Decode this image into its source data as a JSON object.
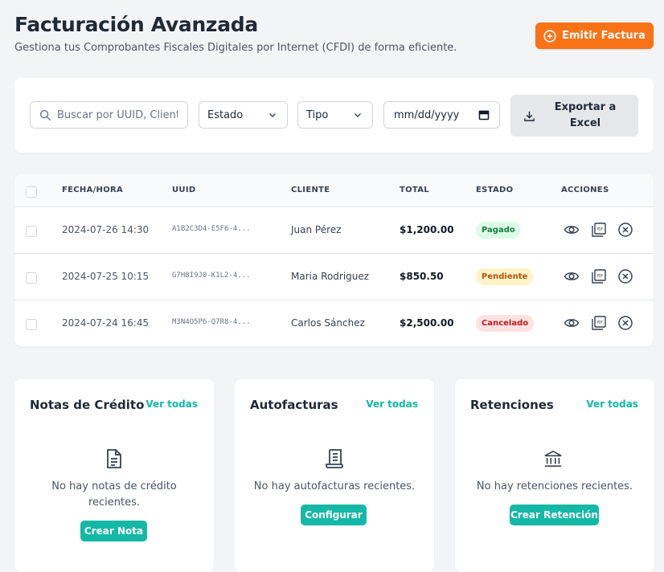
{
  "header": {
    "title": "Facturación Avanzada",
    "subtitle": "Gestiona tus Comprobantes Fiscales Digitales por Internet (CFDI) de forma eficiente.",
    "primary_button": "Emitir Factura",
    "primary_icon": "plus-circle-icon"
  },
  "filters": {
    "search_placeholder": "Buscar por UUID, Cliente...",
    "estado_selected": "Estado",
    "tipo_selected": "Tipo",
    "date_placeholder": "mm/dd/yyyy",
    "export_label": "Exportar a Excel"
  },
  "table": {
    "columns": [
      "FECHA/HORA",
      "UUID",
      "CLIENTE",
      "TOTAL",
      "ESTADO",
      "ACCIONES"
    ],
    "rows": [
      {
        "fecha": "2024-07-26 14:30",
        "uuid": "A1B2C3D4-E5F6-4...",
        "cliente": "Juan Pérez",
        "total": "$1,200.00",
        "estado": "Pagado",
        "status_color": "#15803d"
      },
      {
        "fecha": "2024-07-25 10:15",
        "uuid": "G7H8I9J0-K1L2-4...",
        "cliente": "Maria Rodriguez",
        "total": "$850.50",
        "estado": "Pendiente",
        "status_color": "#b45309"
      },
      {
        "fecha": "2024-07-24 16:45",
        "uuid": "M3N4O5P6-Q7R8-4...",
        "cliente": "Carlos Sánchez",
        "total": "$2,500.00",
        "estado": "Cancelado",
        "status_color": "#b91c1c"
      }
    ],
    "actions": [
      "eye-icon",
      "pdf-icon",
      "cancel-circle-icon"
    ]
  },
  "cards": [
    {
      "title": "Notas de Crédito",
      "link": "Ver todas",
      "icon": "document-icon",
      "message": "No hay notas de crédito recientes.",
      "button": "Crear Nota"
    },
    {
      "title": "Autofacturas",
      "link": "Ver todas",
      "icon": "receipt-icon",
      "message": "No hay autofacturas recientes.",
      "button": "Configurar"
    },
    {
      "title": "Retenciones",
      "link": "Ver todas",
      "icon": "bank-icon",
      "message": "No hay retenciones recientes.",
      "button": "Crear Retención"
    }
  ],
  "colors": {
    "accent_orange": "#f97316",
    "accent_teal": "#14b8a6",
    "background": "#f3f4f6"
  }
}
